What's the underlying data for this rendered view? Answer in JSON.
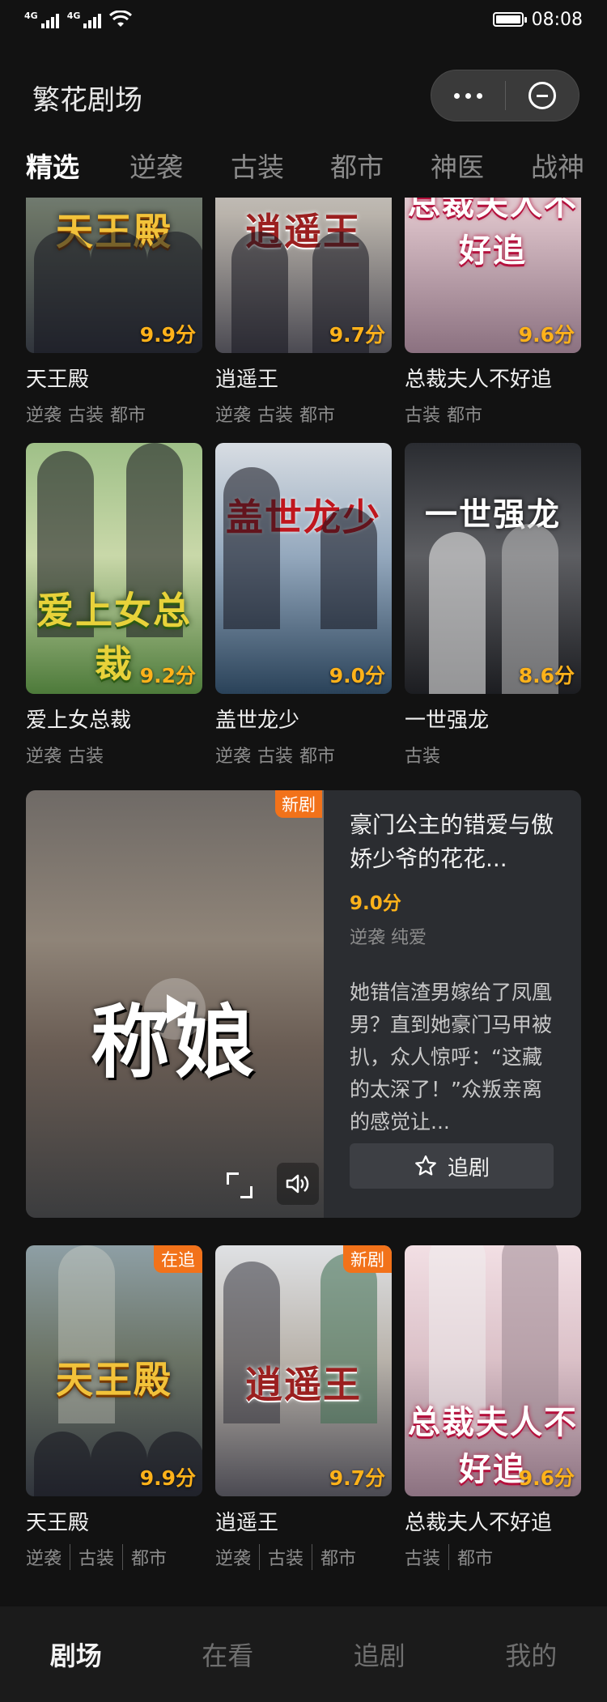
{
  "status_bar": {
    "network_1": "4G",
    "network_2": "4G",
    "time": "08:08",
    "battery_level": 0.9
  },
  "header": {
    "title": "繁花剧场"
  },
  "tabs": [
    "精选",
    "逆袭",
    "古装",
    "都市",
    "神医",
    "战神"
  ],
  "rows": [
    [
      {
        "title": "天王殿",
        "score": "9.9分",
        "tags": [
          "逆袭",
          "古装",
          "都市"
        ],
        "art": "天王殿"
      },
      {
        "title": "逍遥王",
        "score": "9.7分",
        "tags": [
          "逆袭",
          "古装",
          "都市"
        ],
        "art": "逍遥王"
      },
      {
        "title": "总裁夫人不好追",
        "score": "9.6分",
        "tags": [
          "古装",
          "都市"
        ],
        "art": "总裁夫人不好追"
      }
    ],
    [
      {
        "title": "爱上女总裁",
        "score": "9.2分",
        "tags": [
          "逆袭",
          "古装"
        ],
        "art": "爱上女总裁"
      },
      {
        "title": "盖世龙少",
        "score": "9.0分",
        "tags": [
          "逆袭",
          "古装",
          "都市"
        ],
        "art": "盖世龙少"
      },
      {
        "title": "一世强龙",
        "score": "8.6分",
        "tags": [
          "古装"
        ],
        "art": "一世强龙"
      }
    ],
    [
      {
        "title": "天王殿",
        "score": "9.9分",
        "tags": [
          "逆袭",
          "古装",
          "都市"
        ],
        "badge": "在追",
        "art": "天王殿"
      },
      {
        "title": "逍遥王",
        "score": "9.7分",
        "tags": [
          "逆袭",
          "古装",
          "都市"
        ],
        "badge": "新剧",
        "art": "逍遥王"
      },
      {
        "title": "总裁夫人不好追",
        "score": "9.6分",
        "tags": [
          "古装",
          "都市"
        ],
        "art": "总裁夫人不好追"
      }
    ]
  ],
  "featured": {
    "badge": "新剧",
    "video_text": "称娘",
    "title": "豪门公主的错爱与傲娇少爷的花花...",
    "score": "9.0分",
    "tags": "逆袭 纯爱",
    "description": "她错信渣男嫁给了凤凰男？直到她豪门马甲被扒，众人惊呼：“这藏的太深了！”众叛亲离的感觉让...",
    "follow_label": "追剧"
  },
  "bottom_nav": [
    "剧场",
    "在看",
    "追剧",
    "我的"
  ],
  "colors": {
    "background": "#121212",
    "score": "#ffb21a",
    "badge": "#f2721a",
    "card": "#2b2d31"
  }
}
